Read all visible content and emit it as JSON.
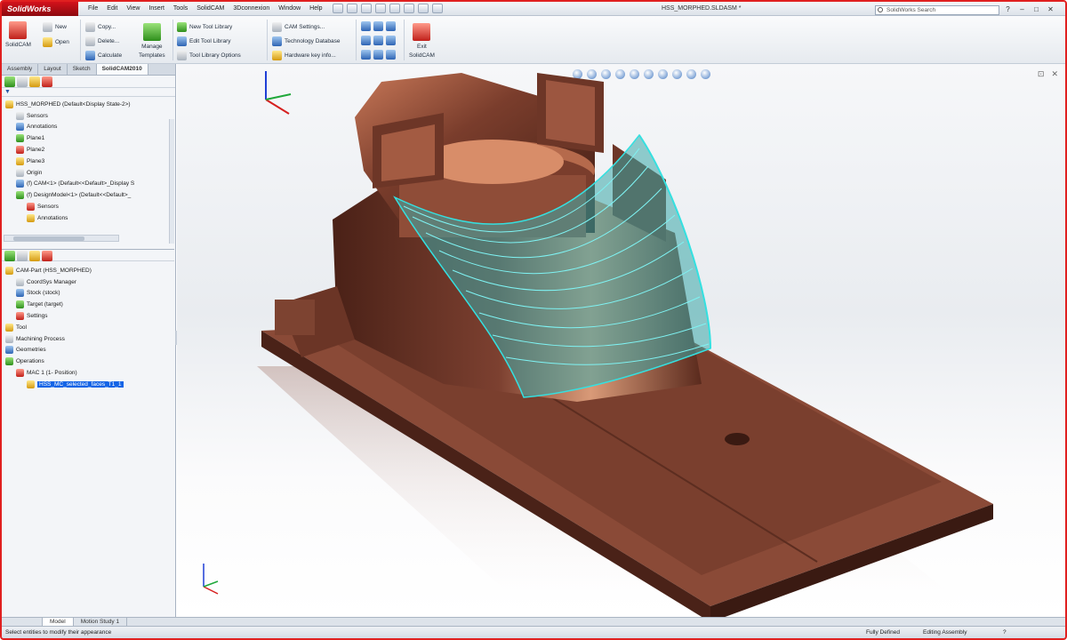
{
  "app": {
    "logo": "SolidWorks",
    "menu": [
      "File",
      "Edit",
      "View",
      "Insert",
      "Tools",
      "SolidCAM",
      "3Dconnexion",
      "Window",
      "Help"
    ],
    "document_title": "HSS_MORPHED.SLDASM *",
    "search_placeholder": "SolidWorks Search"
  },
  "ribbon": {
    "solidcam": "SolidCAM",
    "new": "New",
    "open": "Open",
    "copy": "Copy...",
    "delete": "Delete...",
    "calculate": "Calculate",
    "manage_templates_1": "Manage",
    "manage_templates_2": "Templates",
    "new_tool_library": "New Tool Library",
    "edit_tool_library": "Edit Tool Library",
    "tool_library_options": "Tool Library Options",
    "cam_settings": "CAM Settings...",
    "technology_database": "Technology Database",
    "hardware_key_info": "Hardware key info...",
    "exit_1": "Exit",
    "exit_2": "SolidCAM"
  },
  "panel_tabs": [
    "Assembly",
    "Layout",
    "Sketch",
    "SolidCAM2010"
  ],
  "feature_tree": [
    {
      "label": "HSS_MORPHED  (Default<Display State-2>)",
      "level": 0
    },
    {
      "label": "Sensors",
      "level": 1
    },
    {
      "label": "Annotations",
      "level": 1
    },
    {
      "label": "Plane1",
      "level": 1
    },
    {
      "label": "Plane2",
      "level": 1
    },
    {
      "label": "Plane3",
      "level": 1
    },
    {
      "label": "Origin",
      "level": 1
    },
    {
      "label": "(f) CAM<1> (Default<<Default>_Display S",
      "level": 1
    },
    {
      "label": "(f) DesignModel<1> (Default<<Default>_",
      "level": 1
    },
    {
      "label": "Sensors",
      "level": 2
    },
    {
      "label": "Annotations",
      "level": 2
    }
  ],
  "cam_tree": [
    {
      "label": "CAM-Part (HSS_MORPHED)",
      "level": 0
    },
    {
      "label": "CoordSys Manager",
      "level": 1
    },
    {
      "label": "Stock (stock)",
      "level": 1
    },
    {
      "label": "Target (target)",
      "level": 1
    },
    {
      "label": "Settings",
      "level": 1
    },
    {
      "label": "Tool",
      "level": 0
    },
    {
      "label": "Machining Process",
      "level": 0
    },
    {
      "label": "Geometries",
      "level": 0
    },
    {
      "label": "Operations",
      "level": 0
    },
    {
      "label": "MAC 1 (1- Position)",
      "level": 1
    },
    {
      "label": "HSS_MC_selected_faces_T1_1",
      "level": 2,
      "selected": true
    }
  ],
  "bottom_tabs": [
    "Model",
    "Motion Study 1"
  ],
  "status": {
    "hint": "Select entities to modify their appearance",
    "fully_defined": "Fully Defined",
    "editing": "Editing Assembly"
  },
  "colors": {
    "part_copper": "#6b3526",
    "toolpath_cyan": "#35e0e0",
    "frame_red": "#e02020",
    "selection_blue": "#1464e6"
  }
}
